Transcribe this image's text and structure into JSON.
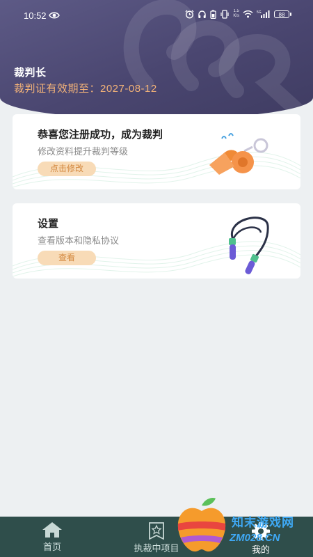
{
  "status_bar": {
    "time": "10:52",
    "net_speed_value": "1.5",
    "net_speed_unit": "K/s",
    "signal_label": "5G",
    "battery": "88"
  },
  "profile": {
    "name": "裁判长",
    "validity": "裁判证有效期至：2027-08-12"
  },
  "cards": [
    {
      "title": "恭喜您注册成功，成为裁判",
      "subtitle": "修改资料提升裁判等级",
      "button": "点击修改",
      "icon": "whistle-icon"
    },
    {
      "title": "设置",
      "subtitle": "查看版本和隐私协议",
      "button": "查看",
      "icon": "jump-rope-icon"
    }
  ],
  "nav": [
    {
      "label": "首页",
      "icon": "home-icon"
    },
    {
      "label": "执裁中项目",
      "icon": "star-badge-icon"
    },
    {
      "label": "我的",
      "icon": "gear-icon",
      "active": true
    }
  ],
  "colors": {
    "header": "#4a4670",
    "accent_orange": "#f2b278",
    "button_bg": "#f8dbb7",
    "nav_bg": "#2f4e4b"
  },
  "watermark": {
    "line1": "知末游戏网",
    "line2": "ZM028.CN"
  }
}
